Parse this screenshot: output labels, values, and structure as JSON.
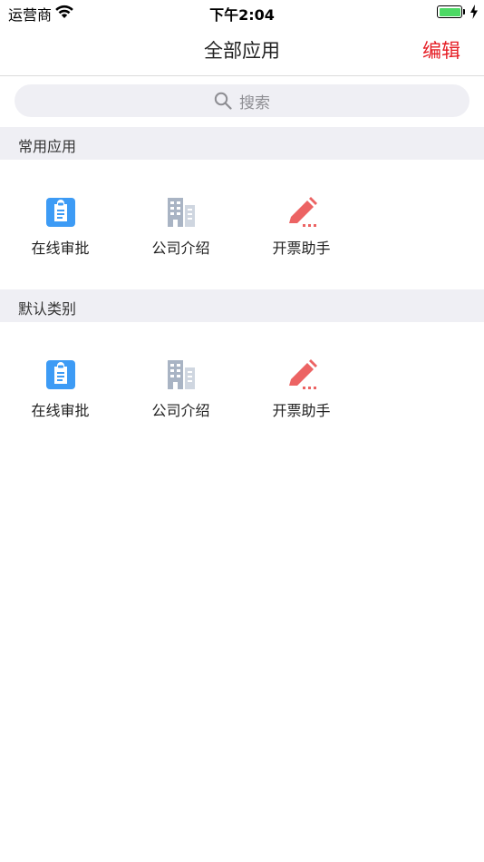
{
  "status_bar": {
    "carrier": "运营商",
    "time": "下午2:04",
    "battery_level": 1.0
  },
  "nav": {
    "title": "全部应用",
    "edit_label": "编辑"
  },
  "search": {
    "placeholder": "搜索"
  },
  "sections": [
    {
      "title": "常用应用",
      "apps": [
        {
          "label": "在线审批",
          "icon": "clipboard-icon"
        },
        {
          "label": "公司介绍",
          "icon": "building-icon"
        },
        {
          "label": "开票助手",
          "icon": "pencil-icon"
        }
      ]
    },
    {
      "title": "默认类别",
      "apps": [
        {
          "label": "在线审批",
          "icon": "clipboard-icon"
        },
        {
          "label": "公司介绍",
          "icon": "building-icon"
        },
        {
          "label": "开票助手",
          "icon": "pencil-icon"
        }
      ]
    }
  ],
  "colors": {
    "accent": "#e51c23",
    "clipboard": "#3d9bf5",
    "building": "#a9b4c4",
    "pencil": "#ec6363",
    "section_bg": "#efeff4"
  }
}
